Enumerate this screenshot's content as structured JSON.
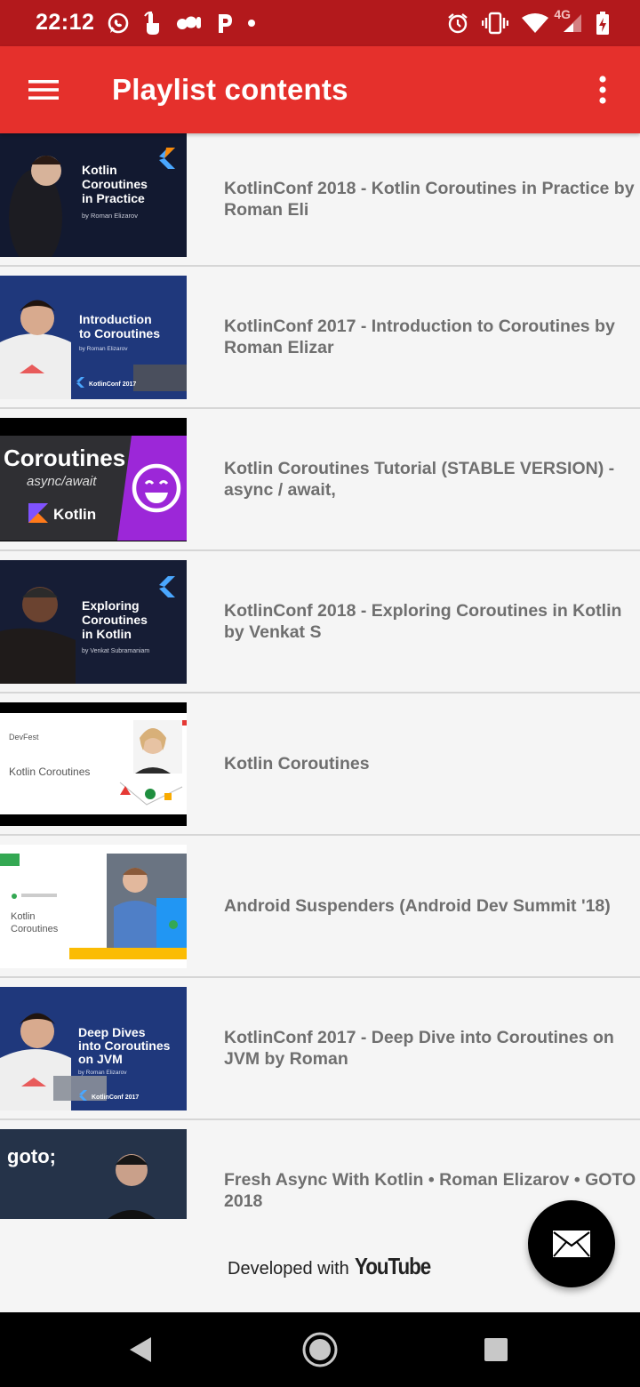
{
  "status_bar": {
    "time": "22:12",
    "network_type": "4G",
    "notification_icons": [
      "whatsapp-icon",
      "touch-icon",
      "bubbles-icon",
      "pandora-icon",
      "dot-icon"
    ],
    "system_icons": [
      "alarm-icon",
      "vibrate-icon",
      "wifi-icon",
      "cell-signal-icon",
      "battery-charging-icon"
    ]
  },
  "app_bar": {
    "title": "Playlist contents",
    "menu_icon": "hamburger-menu-icon",
    "overflow_icon": "more-vert-icon"
  },
  "playlist": {
    "items": [
      {
        "title": "KotlinConf 2018 - Kotlin Coroutines in Practice by Roman Eli",
        "thumb_text": [
          "Kotlin",
          "Coroutines",
          "in Practice",
          "by Roman Elizarov"
        ]
      },
      {
        "title": "KotlinConf 2017 - Introduction to Coroutines by Roman Elizar",
        "thumb_text": [
          "Introduction",
          "to Coroutines",
          "by Roman Elizarov",
          "KotlinConf 2017"
        ]
      },
      {
        "title": "Kotlin Coroutines Tutorial (STABLE VERSION) - async / await,",
        "thumb_text": [
          "Coroutines",
          "async/await",
          "Kotlin"
        ]
      },
      {
        "title": "KotlinConf 2018 - Exploring Coroutines in Kotlin by Venkat S",
        "thumb_text": [
          "Exploring",
          "Coroutines",
          "in Kotlin",
          "by Venkat Subramaniam"
        ]
      },
      {
        "title": "Kotlin Coroutines",
        "thumb_text": [
          "DevFest",
          "Kotlin Coroutines"
        ]
      },
      {
        "title": "Android Suspenders (Android Dev Summit '18)",
        "thumb_text": [
          "Kotlin",
          "Coroutines"
        ]
      },
      {
        "title": "KotlinConf 2017 - Deep Dive into Coroutines on JVM by Roman",
        "thumb_text": [
          "Deep Dives",
          "into Coroutines",
          "on JVM",
          "by Roman Elizarov",
          "KotlinConf 2017"
        ]
      },
      {
        "title": "Fresh Async With Kotlin • Roman Elizarov • GOTO 2018",
        "thumb_text": [
          "goto;"
        ]
      }
    ]
  },
  "footer": {
    "credit_text": "Developed with",
    "credit_brand": "YouTube"
  },
  "fab": {
    "icon": "email-icon"
  },
  "nav_bar": {
    "icons": [
      "back-icon",
      "home-icon",
      "recents-icon"
    ]
  },
  "colors": {
    "status_bar": "#b3191c",
    "app_bar": "#e5302c",
    "list_background": "#f5f5f5",
    "title_text": "#6f6f6f",
    "fab": "#000000",
    "nav_bar": "#000000"
  }
}
